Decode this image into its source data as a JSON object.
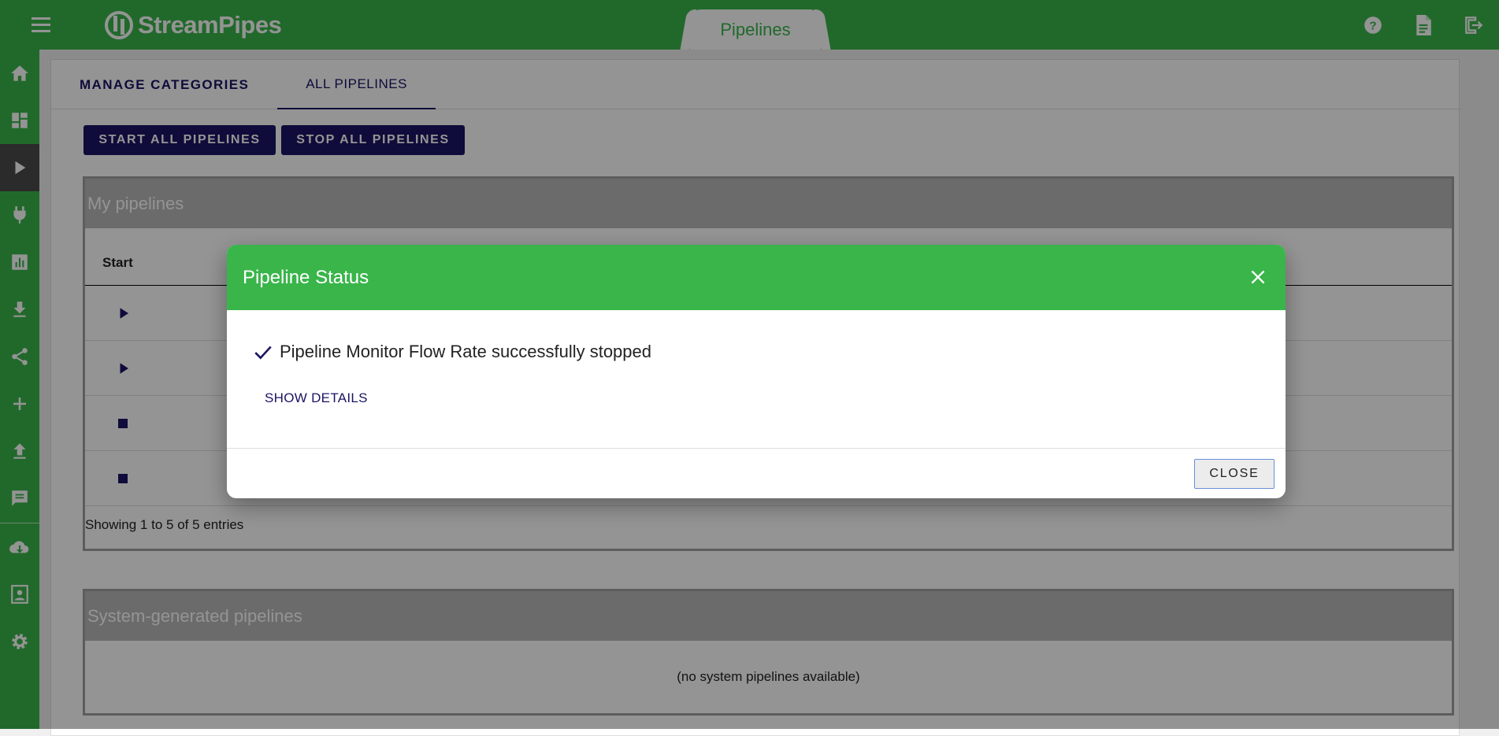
{
  "app": {
    "brand": "StreamPipes",
    "active_view_tab": "Pipelines"
  },
  "top_icons": [
    "help-icon",
    "document-icon",
    "logout-icon"
  ],
  "sidebar": {
    "items": [
      {
        "name": "home-icon"
      },
      {
        "name": "dashboard-icon"
      },
      {
        "name": "pipelines-play-icon",
        "active": true
      },
      {
        "name": "connect-plug-icon"
      },
      {
        "name": "data-explorer-chart-icon"
      },
      {
        "name": "download-icon"
      },
      {
        "name": "share-icon"
      },
      {
        "name": "add-icon"
      },
      {
        "name": "upload-icon"
      },
      {
        "name": "notifications-message-icon"
      },
      {
        "name": "cloud-download-icon"
      },
      {
        "name": "profile-icon"
      },
      {
        "name": "settings-gear-icon"
      }
    ]
  },
  "tabs": {
    "manage_categories": "MANAGE CATEGORIES",
    "all_pipelines": "ALL PIPELINES"
  },
  "actions": {
    "start_all": "START ALL PIPELINES",
    "stop_all": "STOP ALL PIPELINES"
  },
  "my_pipelines": {
    "title": "My pipelines",
    "column_start": "Start",
    "rows": [
      {
        "action": "play-icon"
      },
      {
        "action": "play-icon"
      },
      {
        "action": "stop-icon"
      },
      {
        "action": "stop-icon"
      }
    ],
    "entries_info": "Showing 1 to 5 of 5 entries"
  },
  "system_pipelines": {
    "title": "System-generated pipelines",
    "empty_message": "(no system pipelines available)"
  },
  "dialog": {
    "title": "Pipeline Status",
    "message": "Pipeline Monitor Flow Rate successfully stopped",
    "show_details": "SHOW DETAILS",
    "close_label": "CLOSE"
  },
  "colors": {
    "brand_green": "#39b54a",
    "accent_navy": "#1b1464"
  }
}
